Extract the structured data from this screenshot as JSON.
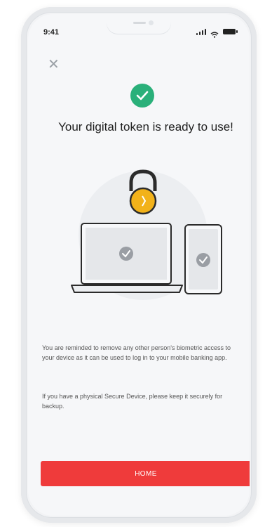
{
  "status_bar": {
    "time": "9:41"
  },
  "title": "Your digital token is ready to use!",
  "messages": [
    "You are reminded to remove any other person's biometric access to your device as it can be used to log in to your mobile banking app.",
    "If you have a physical Secure Device, please keep it securely for backup."
  ],
  "home_button": {
    "label": "HOME"
  },
  "colors": {
    "success": "#2ab07a",
    "accent_lock": "#f2b21a",
    "button": "#ef3b3b"
  },
  "icons": [
    "close-icon",
    "success-check-icon",
    "padlock-icon",
    "laptop-icon",
    "phone-icon"
  ]
}
